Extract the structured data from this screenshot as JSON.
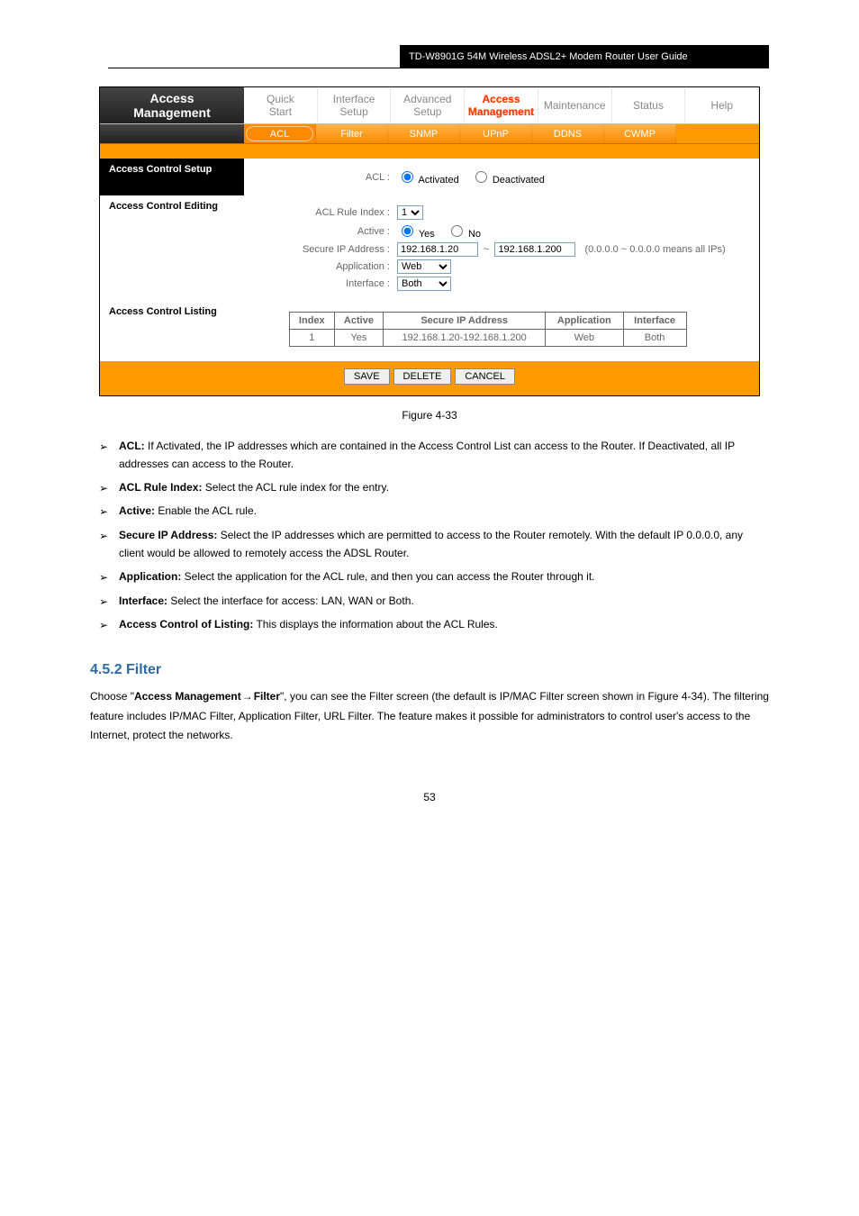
{
  "header_black": "TD-W8901G 54M Wireless ADSL2+ Modem Router User Guide",
  "router": {
    "side_title1": "Access",
    "side_title2": "Management",
    "nav": [
      {
        "l1": "Quick",
        "l2": "Start"
      },
      {
        "l1": "Interface",
        "l2": "Setup"
      },
      {
        "l1": "Advanced",
        "l2": "Setup"
      },
      {
        "l1": "Access",
        "l2": "Management",
        "active": true
      },
      {
        "l1": "Maintenance",
        "l2": ""
      },
      {
        "l1": "Status",
        "l2": ""
      },
      {
        "l1": "Help",
        "l2": ""
      }
    ],
    "subnav": [
      "ACL",
      "Filter",
      "SNMP",
      "UPnP",
      "DDNS",
      "CWMP"
    ],
    "subnav_active": 0,
    "acs_setup_label": "Access Control Setup",
    "acl_label": "ACL :",
    "acl_opts": {
      "a": "Activated",
      "d": "Deactivated"
    },
    "acs_editing_label": "Access Control Editing",
    "rule_index_label": "ACL Rule Index :",
    "rule_index_value": "1",
    "active_label": "Active :",
    "active_yes": "Yes",
    "active_no": "No",
    "secure_ip_label": "Secure IP Address :",
    "ip_from": "192.168.1.20",
    "ip_tilde": "~",
    "ip_to": "192.168.1.200",
    "ip_hint": "(0.0.0.0 ~ 0.0.0.0 means all IPs)",
    "app_label": "Application :",
    "app_value": "Web",
    "iface_label": "Interface :",
    "iface_value": "Both",
    "acs_listing_label": "Access Control Listing",
    "table": {
      "headers": [
        "Index",
        "Active",
        "Secure IP Address",
        "Application",
        "Interface"
      ],
      "row": [
        "1",
        "Yes",
        "192.168.1.20-192.168.1.200",
        "Web",
        "Both"
      ]
    },
    "buttons": {
      "save": "SAVE",
      "delete": "DELETE",
      "cancel": "CANCEL"
    }
  },
  "figure_caption": "Figure 4-33",
  "descs": [
    {
      "b": "ACL:",
      "t": " If Activated, the IP addresses which are contained in the Access Control List can access to the Router. If Deactivated, all IP addresses can access to the Router."
    },
    {
      "b": "ACL Rule Index:",
      "t": " Select the ACL rule index for the entry."
    },
    {
      "b": "Active:",
      "t": " Enable the ACL rule."
    },
    {
      "b": "Secure IP Address:",
      "t": " Select the IP addresses which are permitted to access to the Router remotely. With the default IP 0.0.0.0, any client would be allowed to remotely access the ADSL Router."
    },
    {
      "b": "Application:",
      "t": " Select the application for the ACL rule, and then you can access the Router through it."
    },
    {
      "b": "Interface:",
      "t": " Select the interface for access: LAN, WAN or Both."
    },
    {
      "b": "Access Control of Listing:",
      "t": " This displays the information about the ACL Rules."
    }
  ],
  "filter_heading": "4.5.2 Filter",
  "filter_p1_a": "Choose \"",
  "filter_p1_b": "Access Management",
  "filter_p1_arrow": "→",
  "filter_p1_c": "Filter",
  "filter_p1_d": "\", you can see the Filter screen (the default is IP/MAC Filter screen shown in Figure 4-34). The filtering feature includes IP/MAC Filter, Application Filter, URL Filter. The feature makes it possible for administrators to control user's access to the Internet, protect the networks.",
  "page_num": "53"
}
